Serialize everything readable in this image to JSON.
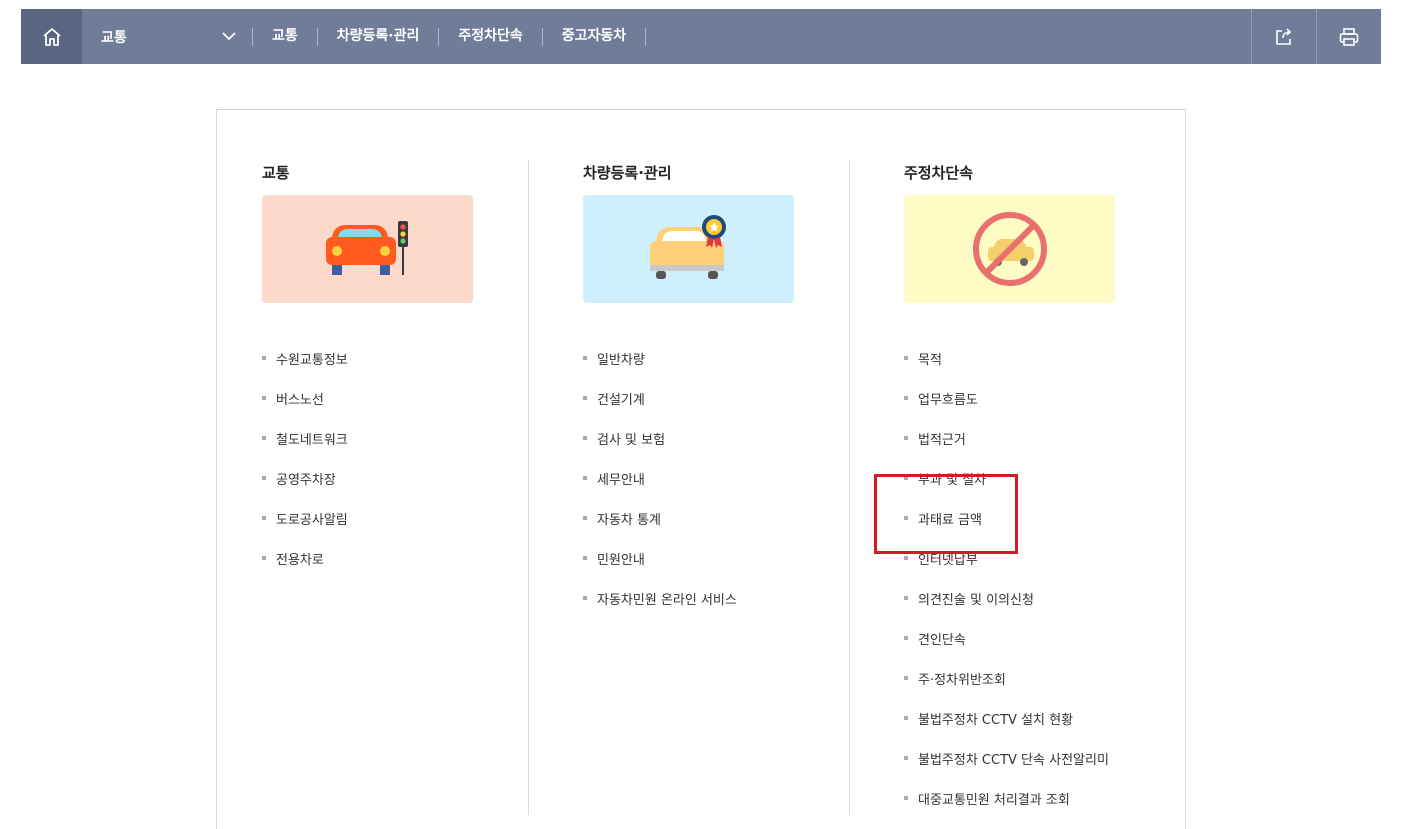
{
  "nav": {
    "dropdown_label": "교통",
    "links": [
      "교통",
      "차량등록·관리",
      "주정차단속",
      "중고자동차"
    ]
  },
  "columns": [
    {
      "title": "교통",
      "image_bg": "#fdd9cb",
      "items": [
        "수원교통정보",
        "버스노선",
        "철도네트워크",
        "공영주차장",
        "도로공사알림",
        "전용차로"
      ]
    },
    {
      "title": "차량등록·관리",
      "image_bg": "#cdf0fc",
      "items": [
        "일반차량",
        "건설기계",
        "검사 및 보험",
        "세무안내",
        "자동차 통계",
        "민원안내",
        "자동차민원 온라인 서비스"
      ]
    },
    {
      "title": "주정차단속",
      "image_bg": "#fefcc4",
      "items": [
        "목적",
        "업무흐름도",
        "법적근거",
        "부과 및 절차",
        "과태료 금액",
        "인터넷납부",
        "의견진술 및 이의신청",
        "견인단속",
        "주·정차위반조회",
        "불법주정차 CCTV 설치 현황",
        "불법주정차 CCTV 단속 사전알리미",
        "대중교통민원 처리결과 조회"
      ]
    }
  ],
  "colors": {
    "topbar": "#707c98",
    "home": "#5a6582",
    "highlight": "#d51a25"
  },
  "icons": {
    "home": "home-icon",
    "dropdown": "chevron-down-icon",
    "share": "share-icon",
    "print": "print-icon"
  }
}
